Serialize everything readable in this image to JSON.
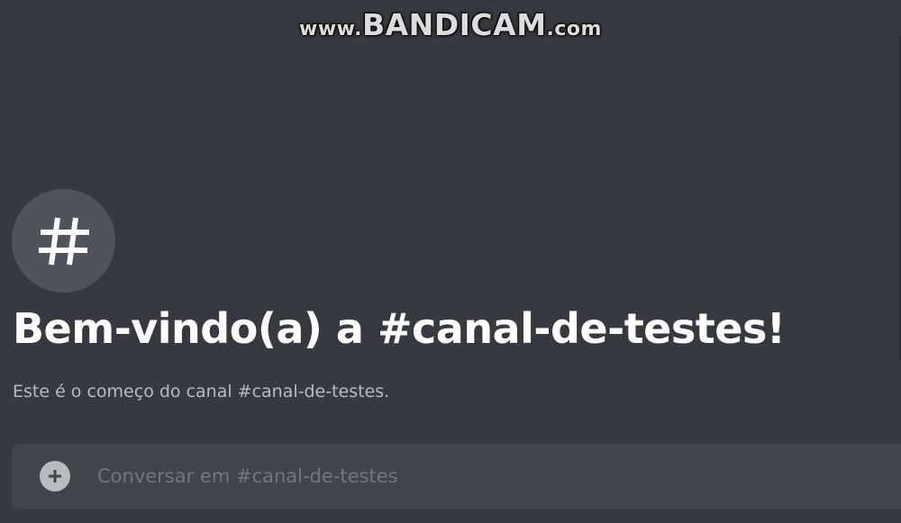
{
  "watermark": {
    "www": "www.",
    "brand": "BANDICAM",
    "com": ".com"
  },
  "channel": {
    "icon": "hashtag-icon",
    "welcome_title": "Bem-vindo(a) a #canal-de-testes!",
    "welcome_subtitle": "Este é o começo do canal #canal-de-testes."
  },
  "composer": {
    "add_icon": "plus-circle-icon",
    "placeholder": "Conversar em #canal-de-testes",
    "value": ""
  },
  "colors": {
    "background": "#36393f",
    "composer_background": "#40444b",
    "icon_circle": "#4f545c",
    "title": "#ffffff",
    "subtitle": "#b9bbbe",
    "placeholder": "#72767d"
  }
}
